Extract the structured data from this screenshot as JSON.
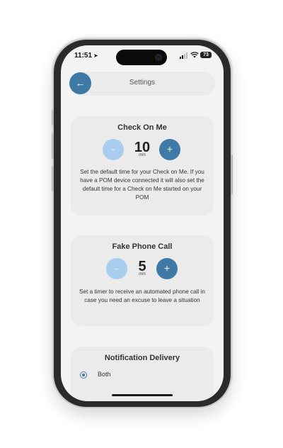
{
  "status_bar": {
    "time": "11:51",
    "battery": "73"
  },
  "header": {
    "title": "Settings"
  },
  "check_on_me": {
    "title": "Check On Me",
    "value": "10",
    "unit": "min",
    "minus_label": "-",
    "plus_label": "+",
    "description": "Set the default time for your Check on Me. If you have a POM device connected it will also set the default time for a Check on Me started on your POM"
  },
  "fake_phone_call": {
    "title": "Fake Phone Call",
    "value": "5",
    "unit": "min",
    "minus_label": "-",
    "plus_label": "+",
    "description": "Set a timer to receive an automated phone call in case you need an excuse to leave a situation"
  },
  "notification_delivery": {
    "title": "Notification Delivery",
    "options": [
      {
        "label": "Both",
        "selected": true
      }
    ]
  },
  "colors": {
    "accent": "#3f7aa7",
    "accent_light": "#a9cdee",
    "card": "#ebebeb",
    "background": "#f3f3f3"
  }
}
